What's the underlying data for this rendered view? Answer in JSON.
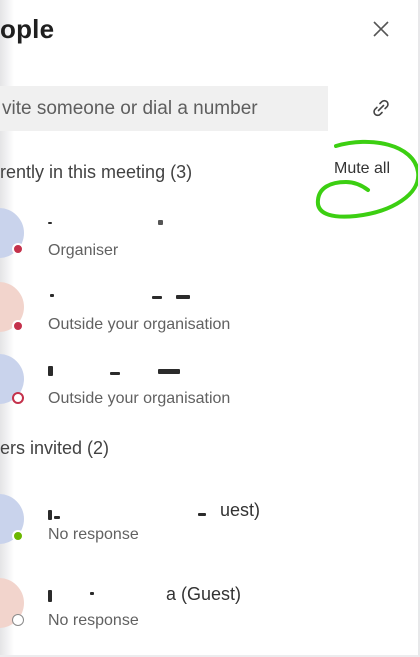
{
  "header": {
    "title": "ople"
  },
  "invite": {
    "placeholder": "vite someone or dial a number"
  },
  "sections": {
    "in_meeting_label": "rently in this meeting (3)",
    "invited_label": "ers invited (2)"
  },
  "actions": {
    "mute_all_label": "Mute all"
  },
  "in_meeting": [
    {
      "name_visible": "",
      "subtitle": "Organiser",
      "presence": "busy"
    },
    {
      "name_visible": "",
      "subtitle": "Outside your organisation",
      "presence": "busy"
    },
    {
      "name_visible": "",
      "subtitle": "Outside your organisation",
      "presence": "offline"
    }
  ],
  "invited": [
    {
      "name_visible": "uest)",
      "subtitle": "No response",
      "presence": "available"
    },
    {
      "name_visible": "a (Guest)",
      "subtitle": "No response",
      "presence": "unknown"
    }
  ],
  "colors": {
    "busy": "#c4314b",
    "available": "#6bb700",
    "offline_ring": "#c4314b",
    "annotation": "#39d10f",
    "avatar_blue": "#c9d3ec",
    "avatar_peach": "#f2d4cc"
  },
  "icons": {
    "close": "close-icon",
    "link": "link-icon"
  }
}
